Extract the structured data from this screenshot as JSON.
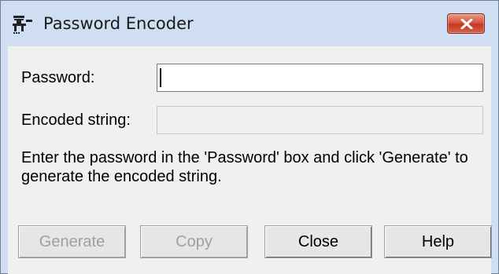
{
  "window": {
    "title": "Password Encoder",
    "icon": "app-encoder-icon"
  },
  "titlebar": {
    "close_icon": "close-icon",
    "close_color": "#c9452b"
  },
  "form": {
    "password_label": "Password:",
    "password_value": "",
    "encoded_label": "Encoded string:",
    "encoded_value": ""
  },
  "instruction": "Enter the password in the 'Password' box and click 'Generate' to generate the encoded string.",
  "buttons": {
    "generate": "Generate",
    "copy": "Copy",
    "close": "Close",
    "help": "Help"
  },
  "state": {
    "generate_enabled": false,
    "copy_enabled": false,
    "close_enabled": true,
    "help_enabled": true
  }
}
